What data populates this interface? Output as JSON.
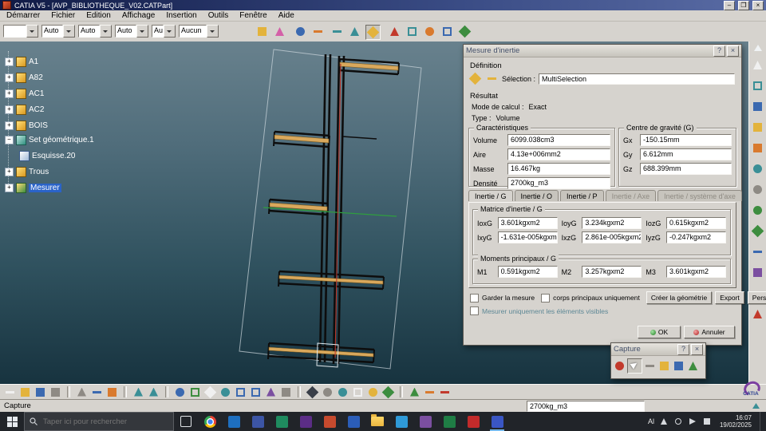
{
  "window": {
    "title": "CATIA V5 - [AVP_BIBLIOTHEQUE_V02.CATPart]"
  },
  "glyphs": {
    "close": "×",
    "help": "?",
    "min": "–",
    "max": "❐",
    "plus": "+",
    "minus": "−"
  },
  "menu": {
    "items": [
      "Démarrer",
      "Fichier",
      "Edition",
      "Affichage",
      "Insertion",
      "Outils",
      "Fenêtre",
      "Aide"
    ]
  },
  "toolbar": {
    "combos": [
      "",
      "Auto",
      "Auto",
      "Auto",
      "Auto",
      "Aucun"
    ]
  },
  "tree": {
    "items": [
      {
        "label": "A1"
      },
      {
        "label": "A82"
      },
      {
        "label": "AC1"
      },
      {
        "label": "AC2"
      },
      {
        "label": "BOIS"
      },
      {
        "label": "Set géométrique.1"
      },
      {
        "label": "Esquisse.20"
      },
      {
        "label": "Trous"
      },
      {
        "label": "Mesurer"
      }
    ]
  },
  "dlg": {
    "title": "Mesure d'inertie",
    "definition_label": "Définition",
    "selection_label": "Sélection :",
    "selection_value": "MultiSelection",
    "resultat_label": "Résultat",
    "mode_label": "Mode de calcul :",
    "mode_value": "Exact",
    "type_label": "Type :",
    "type_value": "Volume",
    "carac": {
      "title": "Caractéristiques",
      "rows": [
        {
          "l": "Volume",
          "v": "6099.038cm3"
        },
        {
          "l": "Aire",
          "v": "4.13e+006mm2"
        },
        {
          "l": "Masse",
          "v": "16.467kg"
        },
        {
          "l": "Densité",
          "v": "2700kg_m3"
        }
      ]
    },
    "centre": {
      "title": "Centre de gravité (G)",
      "rows": [
        {
          "l": "Gx",
          "v": "-150.15mm"
        },
        {
          "l": "Gy",
          "v": "6.612mm"
        },
        {
          "l": "Gz",
          "v": "688.399mm"
        }
      ]
    },
    "tabs": [
      "Inertie / G",
      "Inertie / O",
      "Inertie / P",
      "Inertie / Axe",
      "Inertie / système d'axe"
    ],
    "matrice": {
      "title": "Matrice d'inertie / G",
      "r1": [
        {
          "l": "IoxG",
          "v": "3.601kgxm2"
        },
        {
          "l": "IoyG",
          "v": "3.234kgxm2"
        },
        {
          "l": "IozG",
          "v": "0.615kgxm2"
        }
      ],
      "r2": [
        {
          "l": "IxyG",
          "v": "-1.631e-005kgxm2"
        },
        {
          "l": "IxzG",
          "v": "2.861e-005kgxm2"
        },
        {
          "l": "IyzG",
          "v": "-0.247kgxm2"
        }
      ]
    },
    "moments": {
      "title": "Moments principaux / G",
      "rows": [
        {
          "l": "M1",
          "v": "0.591kgxm2"
        },
        {
          "l": "M2",
          "v": "3.257kgxm2"
        },
        {
          "l": "M3",
          "v": "3.601kgxm2"
        }
      ]
    },
    "cb_keep": "Garder la mesure",
    "cb_bodies": "corps principaux uniquement",
    "cb_visible": "Mesurer uniquement les éléments visibles",
    "btn_create": "Créer la géométrie",
    "btn_export": "Export",
    "btn_custom": "Personnaliser...",
    "btn_ok": "OK",
    "btn_cancel": "Annuler"
  },
  "capture": {
    "title": "Capture"
  },
  "statusbar": {
    "message": "Capture",
    "field_value": "2700kg_m3"
  },
  "taskbar": {
    "search_placeholder": "Taper ici pour rechercher",
    "tray_text": "Al",
    "time": "16:07",
    "date": "19/02/2025"
  },
  "branding": {
    "logo_text": "CATIA"
  }
}
